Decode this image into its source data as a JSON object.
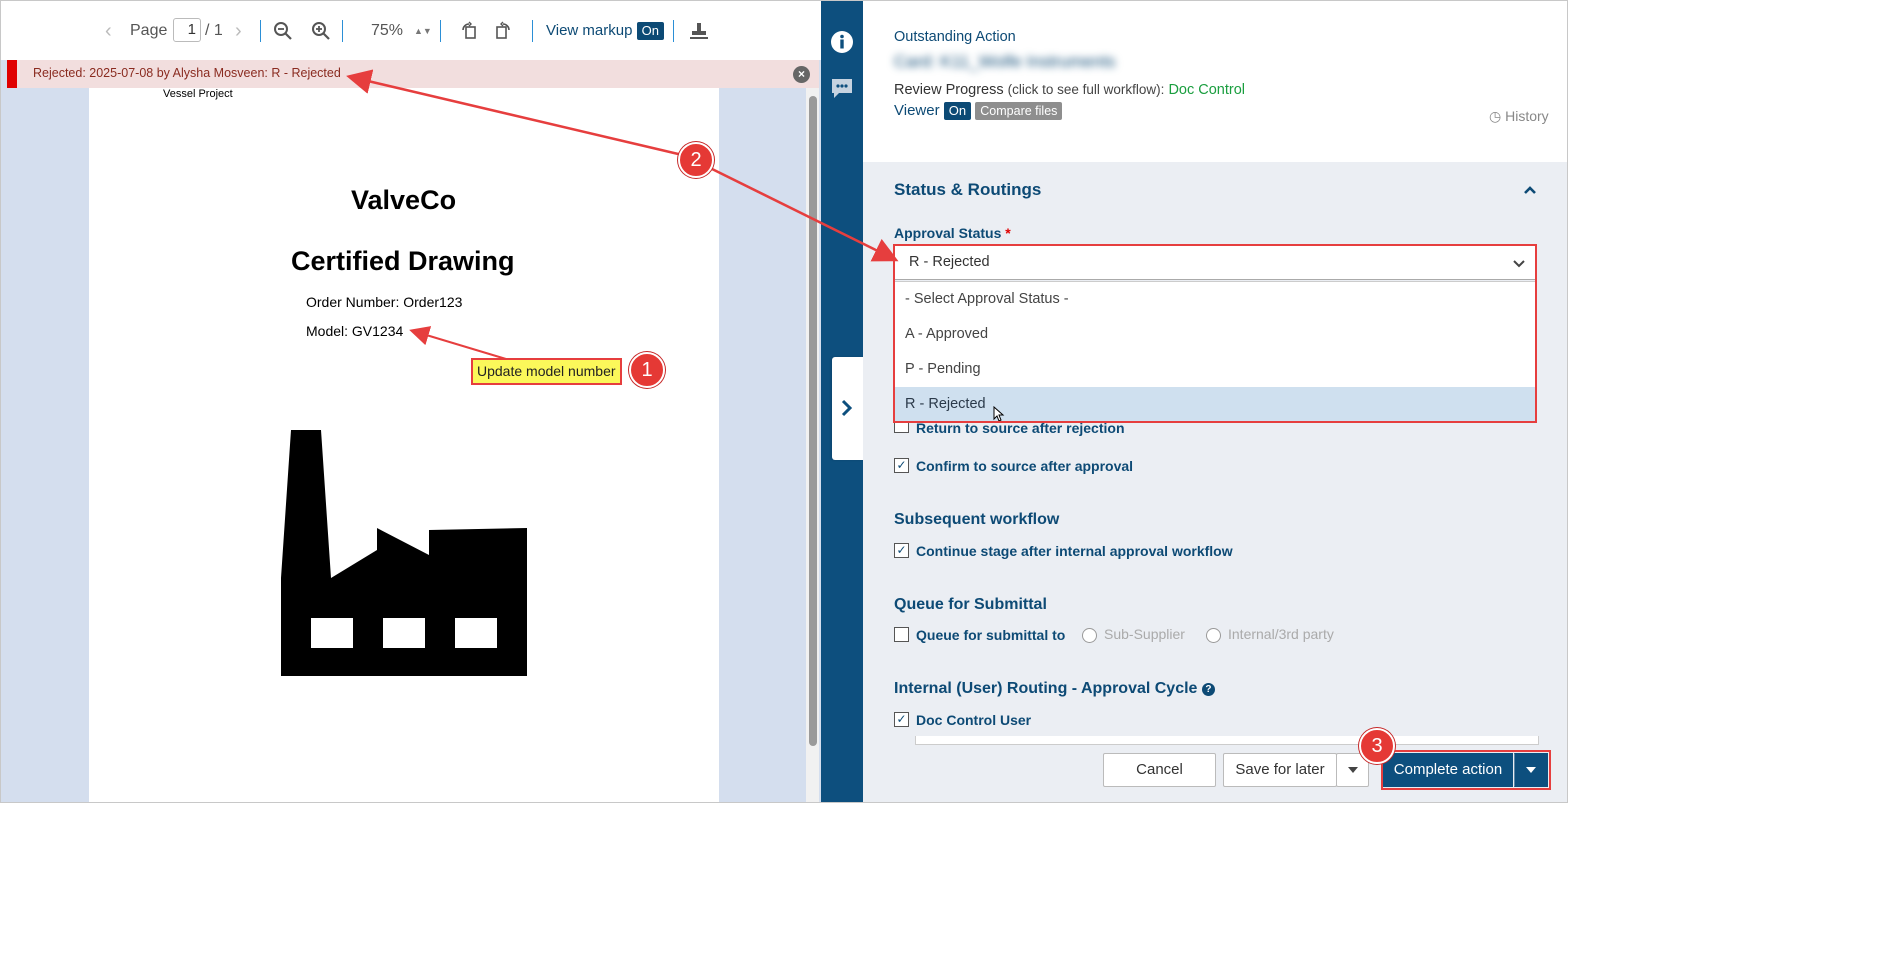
{
  "viewer": {
    "toolbar": {
      "page_label": "Page",
      "page_value": "1",
      "page_total": "/ 1",
      "zoom": "75%",
      "view_markup_label": "View markup",
      "view_markup_state": "On"
    },
    "rejection_banner": "Rejected: 2025-07-08 by Alysha Mosveen: R - Rejected",
    "document": {
      "project": "Vessel Project",
      "company": "ValveCo",
      "title": "Certified Drawing",
      "order": "Order Number: Order123",
      "model": "Model: GV1234"
    },
    "markup_note": "Update model number"
  },
  "callouts": [
    "1",
    "2",
    "3"
  ],
  "panel": {
    "header": {
      "title": "Outstanding Action",
      "card_name": "Card: K11_Wolfe Instruments",
      "review_progress_label": "Review Progress",
      "review_progress_hint": "(click to see full workflow):",
      "review_progress_link": "Doc Control",
      "viewer_label": "Viewer",
      "viewer_state": "On",
      "compare_files": "Compare files",
      "history": "History"
    },
    "status_routings": {
      "title": "Status & Routings",
      "approval_status_label": "Approval Status",
      "required_mark": "*",
      "selected_value": "R - Rejected",
      "options": [
        "- Select Approval Status -",
        "A - Approved",
        "P - Pending",
        "R - Rejected"
      ],
      "return_to_source": "Return to source after rejection",
      "confirm_to_source": "Confirm to source after approval"
    },
    "subsequent_workflow": {
      "title": "Subsequent workflow",
      "continue_stage": "Continue stage after internal approval workflow"
    },
    "queue_for_submittal": {
      "title": "Queue for Submittal",
      "queue_label": "Queue for submittal to",
      "options": [
        "Sub-Supplier",
        "Internal/3rd party"
      ]
    },
    "internal_routing": {
      "title": "Internal (User) Routing - Approval Cycle",
      "doc_control_user": "Doc Control User"
    },
    "footer": {
      "cancel": "Cancel",
      "save_for_later": "Save for later",
      "complete_action": "Complete action"
    }
  },
  "colors": {
    "primary": "#0d4f7e",
    "link_green": "#1a9e3f",
    "reject_red": "#e00000",
    "annotation_red": "#e63e3e",
    "markup_yellow": "#fbf85a"
  }
}
